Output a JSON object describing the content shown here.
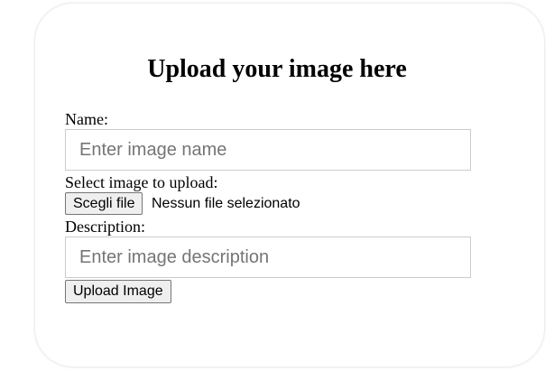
{
  "form": {
    "title": "Upload your image here",
    "name_label": "Name:",
    "name_placeholder": "Enter image name",
    "file_label": "Select image to upload:",
    "file_button": "Scegli file",
    "file_status": "Nessun file selezionato",
    "description_label": "Description:",
    "description_placeholder": "Enter image description",
    "submit_label": "Upload Image"
  }
}
